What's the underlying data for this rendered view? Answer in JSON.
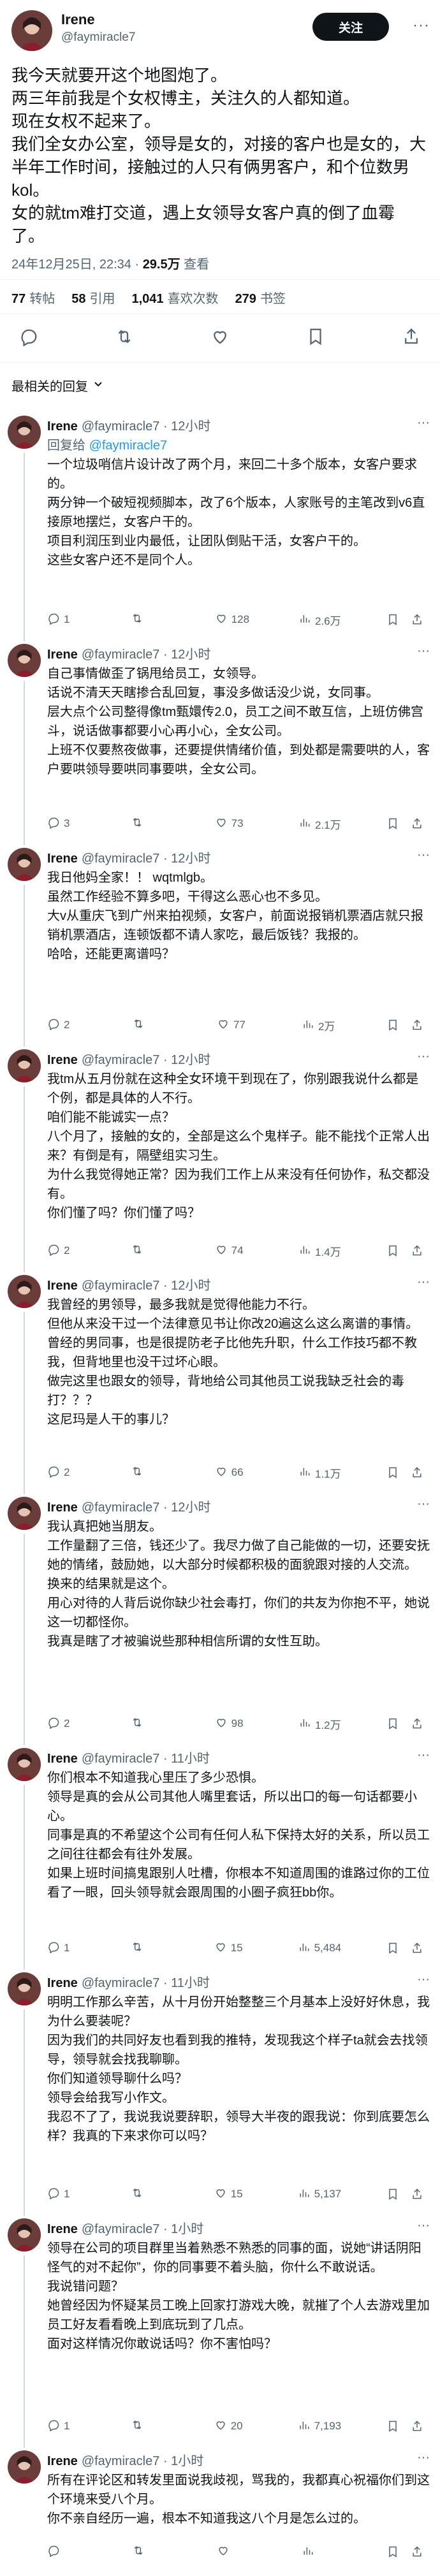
{
  "post": {
    "name": "Irene",
    "handle": "@faymiracle7",
    "follow_label": "关注",
    "lines": [
      "我今天就要开这个地图炮了。",
      "两三年前我是个女权博主，关注久的人都知道。",
      "现在女权不起来了。",
      "我们全女办公室，领导是女的，对接的客户也是女的，大半年工作时间，接触过的人只有俩男客户，和个位数男kol。",
      "女的就tm难打交道，遇上女领导女客户真的倒了血霉了。"
    ],
    "timestamp": "24年12月25日, 22:34 · ",
    "views_value": "29.5万",
    "views_label": " 查看",
    "stats": [
      {
        "value": "77",
        "label": "转帖"
      },
      {
        "value": "58",
        "label": "引用"
      },
      {
        "value": "1,041",
        "label": "喜欢次数"
      },
      {
        "value": "279",
        "label": "书签"
      }
    ],
    "sort_label": "最相关的回复"
  },
  "replies": [
    {
      "name": "Irene",
      "handle": "@faymiracle7",
      "time": "· 12小时",
      "reply_to_prefix": "回复给 ",
      "reply_to": "@faymiracle7",
      "lines": [
        "一个垃圾哨信片设计改了两个月，来回二十多个版本，女客户要求的。",
        "两分钟一个破短视频脚本，改了6个版本，人家账号的主笔改到v6直接原地摆烂，女客户干的。",
        "项目利润压到业内最低，让团队倒贴干活，女客户干的。",
        "这些女客户还不是同个人。"
      ],
      "replies": "1",
      "retweets": "",
      "likes": "128",
      "views": "2.6万"
    },
    {
      "name": "Irene",
      "handle": "@faymiracle7",
      "time": "· 12小时",
      "lines": [
        "自己事情做歪了锅甩给员工，女领导。",
        "话说不清天天瞎掺合乱回复，事没多做话没少说，女同事。",
        "层大点个公司整得像tm甄嬛传2.0，员工之间不敢互信，上班仿佛宫斗，说话做事都要小心再小心，全女公司。",
        "上班不仅要熬夜做事，还要提供情绪价值，到处都是需要哄的人，客户要哄领导要哄同事要哄，全女公司。"
      ],
      "replies": "3",
      "retweets": "",
      "likes": "73",
      "views": "2.1万"
    },
    {
      "name": "Irene",
      "handle": "@faymiracle7",
      "time": "· 12小时",
      "lines": [
        "我日他妈全家！！ wqtmlgb。",
        "虽然工作经验不算多吧，干得这么恶心也不多见。",
        "大v从重庆飞到广州来拍视频，女客户，前面说报销机票酒店就只报销机票酒店，连顿饭都不请人家吃，最后饭钱？我报的。",
        "哈哈，还能更离谱吗？"
      ],
      "replies": "2",
      "retweets": "",
      "likes": "77",
      "views": "2万"
    },
    {
      "name": "Irene",
      "handle": "@faymiracle7",
      "time": "· 12小时",
      "lines": [
        "我tm从五月份就在这种全女环境干到现在了，你别跟我说什么都是个例，都是具体的人不行。",
        "咱们能不能诚实一点？",
        "八个月了，接触的女的，全部是这么个鬼样子。能不能找个正常人出来？有倒是有，隔壁组实习生。",
        "为什么我觉得她正常？因为我们工作上从来没有任何协作，私交都没有。",
        "你们懂了吗？你们懂了吗？"
      ],
      "replies": "2",
      "retweets": "",
      "likes": "74",
      "views": "1.4万"
    },
    {
      "name": "Irene",
      "handle": "@faymiracle7",
      "time": "· 12小时",
      "lines": [
        "我曾经的男领导，最多我就是觉得他能力不行。",
        "但他从来没干过一个法律意见书让你改20遍这么这么离谱的事情。",
        "曾经的男同事，也是很提防老子比他先升职，什么工作技巧都不教我，但背地里也没干过坏心眼。",
        "做完这里也跟女的领导，背地给公司其他员工说我缺乏社会的毒打？？？",
        "这尼玛是人干的事儿？"
      ],
      "replies": "2",
      "retweets": "",
      "likes": "66",
      "views": "1.1万"
    },
    {
      "name": "Irene",
      "handle": "@faymiracle7",
      "time": "· 12小时",
      "lines": [
        "我认真把她当朋友。",
        "工作量翻了三倍，钱还少了。我尽力做了自己能做的一切，还要安抚她的情绪，鼓励她，以大部分时候都积极的面貌跟对接的人交流。",
        "换来的结果就是这个。",
        "用心对待的人背后说你缺少社会毒打，你们的共友为你抱不平，她说这一切都怪你。",
        "我真是瞎了才被骗说些那种相信所谓的女性互助。"
      ],
      "replies": "2",
      "retweets": "",
      "likes": "98",
      "views": "1.2万"
    },
    {
      "name": "Irene",
      "handle": "@faymiracle7",
      "time": "· 11小时",
      "lines": [
        "你们根本不知道我心里压了多少恐惧。",
        "领导是真的会从公司其他人嘴里套话，所以出口的每一句话都要小心。",
        "同事是真的不希望这个公司有任何人私下保持太好的关系，所以员工之间往往都会有往外发展。",
        "如果上班时间搞鬼跟别人吐槽，你根本不知道周围的谁路过你的工位看了一眼，回头领导就会跟周围的小圈子疯狂bb你。"
      ],
      "replies": "1",
      "retweets": "",
      "likes": "15",
      "views": "5,484"
    },
    {
      "name": "Irene",
      "handle": "@faymiracle7",
      "time": "· 11小时",
      "lines": [
        "明明工作那么辛苦，从十月份开始整整三个月基本上没好好休息，我为什么要装呢？",
        "因为我们的共同好友也看到我的推特，发现我这个样子ta就会去找领导，领导就会找我聊聊。",
        "你们知道领导聊什么吗？",
        "领导会给我写小作文。",
        "我忍不了了，我说我说要辞职，领导大半夜的跟我说：你到底要怎么样？我真的下来求你可以吗？"
      ],
      "replies": "1",
      "retweets": "",
      "likes": "15",
      "views": "5,137"
    },
    {
      "name": "Irene",
      "handle": "@faymiracle7",
      "time": "· 1小时",
      "lines": [
        "领导在公司的项目群里当着熟悉不熟悉的同事的面，说她“讲话阴阳怪气的对不起你”，你的同事要不着头脑，你什么不敢说话。",
        "我说错问题？",
        "她曾经因为怀疑某员工晚上回家打游戏大晚，就摧了个人去游戏里加员工好友看看晚上到底玩到了几点。",
        "面对这样情况你敢说话吗？你不害怕吗？"
      ],
      "replies": "1",
      "retweets": "",
      "likes": "20",
      "views": "7,193"
    },
    {
      "name": "Irene",
      "handle": "@faymiracle7",
      "time": "· 1小时",
      "lines": [
        "所有在评论区和转发里面说我歧视，骂我的，我都真心祝福你们到这个环境来受八个月。",
        "你不亲自经历一遍，根本不知道我这八个月是怎么过的。"
      ],
      "replies": "",
      "retweets": "",
      "likes": "",
      "views": ""
    }
  ]
}
